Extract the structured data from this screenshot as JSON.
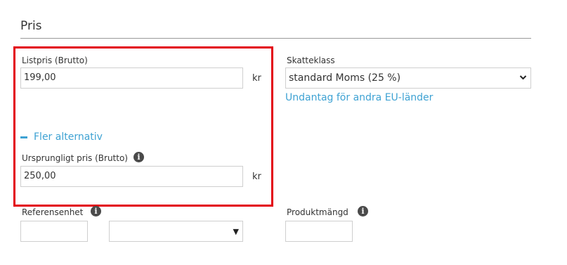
{
  "section": {
    "title": "Pris"
  },
  "list_price": {
    "label": "Listpris (Brutto)",
    "value": "199,00",
    "unit": "kr"
  },
  "tax": {
    "label": "Skatteklass",
    "selected": "standard Moms (25 %)",
    "exception_link": "Undantag för andra EU-länder"
  },
  "more_options": {
    "label": "Fler alternativ"
  },
  "original_price": {
    "label": "Ursprungligt pris (Brutto)",
    "value": "250,00",
    "unit": "kr"
  },
  "reference_unit": {
    "label": "Referensenhet",
    "value": "",
    "unit_selected": ""
  },
  "product_quantity": {
    "label": "Produktmängd",
    "value": ""
  },
  "icons": {
    "info": "info-icon",
    "minus": "minus-icon",
    "caret": "chevron-down-icon"
  },
  "colors": {
    "link": "#3ea2d3",
    "highlight": "#e3000f"
  }
}
